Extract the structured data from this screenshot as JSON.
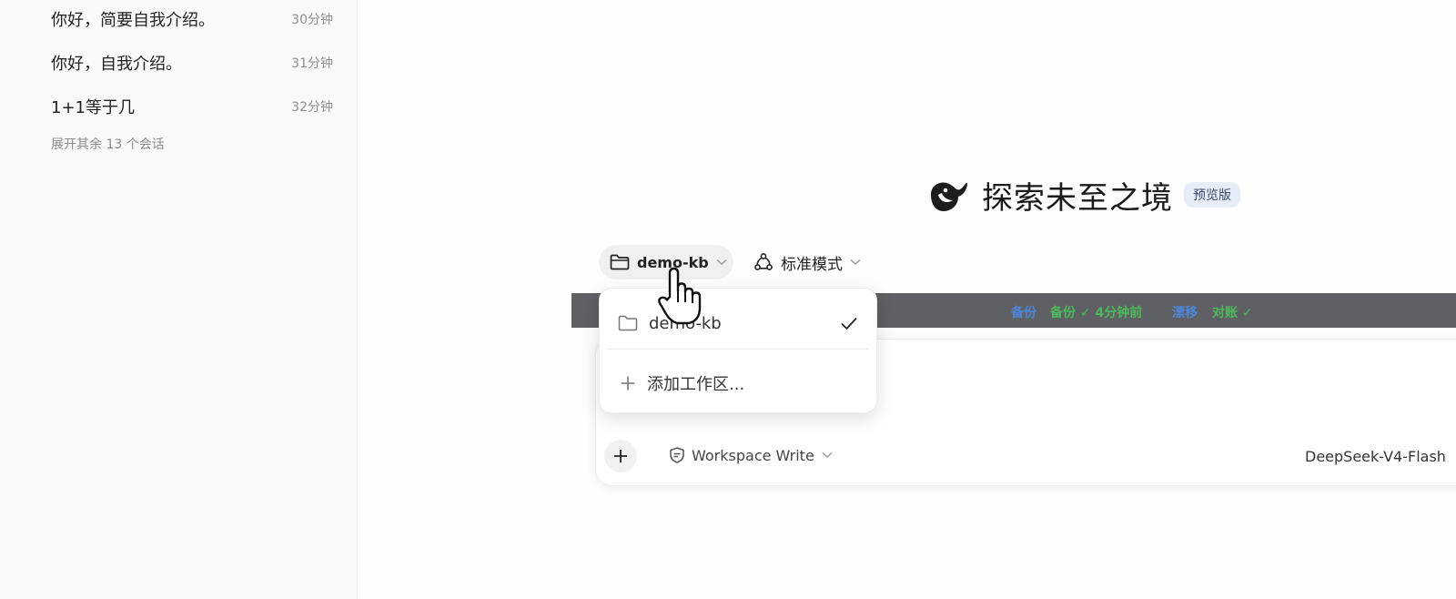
{
  "sidebar": {
    "conversations": [
      {
        "title": "你好，简要自我介绍。",
        "time": "30分钟"
      },
      {
        "title": "你好，自我介绍。",
        "time": "31分钟"
      },
      {
        "title": "1+1等于几",
        "time": "32分钟"
      }
    ],
    "expand_label": "展开其余 13 个会话"
  },
  "hero": {
    "title": "探索未至之境",
    "badge": "预览版",
    "logo_icon": "whale-logo-icon"
  },
  "toolbar": {
    "workspace_label": "demo-kb",
    "workspace_icon": "folder-icon",
    "mode_label": "标准模式",
    "mode_icon": "cycle-nodes-icon"
  },
  "status_bar": {
    "items": [
      {
        "text": "备份",
        "color": "#4f86d9"
      },
      {
        "text": "备份 ✓ 4分钟前",
        "color": "#4cbb5c"
      },
      {
        "text": "漂移",
        "color": "#4f86d9"
      },
      {
        "text": "对账 ✓",
        "color": "#4cbb5c"
      }
    ]
  },
  "dropdown": {
    "items": [
      {
        "label": "demo-kb",
        "icon": "folder-icon",
        "selected": true,
        "check_icon": "check-icon"
      },
      {
        "label": "添加工作区...",
        "icon": "plus-icon"
      }
    ]
  },
  "input": {
    "permission_label": "Workspace Write",
    "permission_icon": "shield-icon",
    "model_label": "DeepSeek-V4-Flash"
  },
  "colors": {
    "sidebar_bg": "#f9f9fb",
    "status_bg": "#5e6063",
    "badge_bg": "#e6ecf8"
  }
}
